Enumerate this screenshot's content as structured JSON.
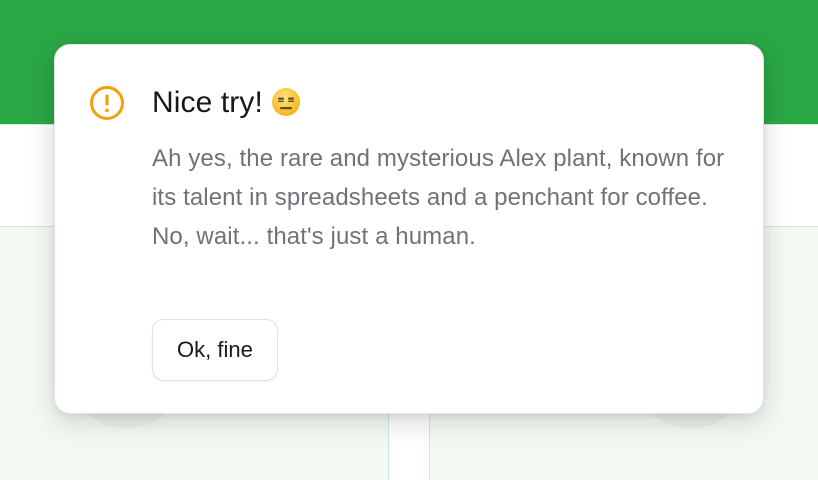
{
  "dialog": {
    "title": "Nice try!",
    "emoji": "😑",
    "icon": "warning-circle-icon",
    "message": "Ah yes, the rare and mysterious Alex plant, known for its talent in spreadsheets and a penchant for coffee. No, wait... that's just a human.",
    "button_label": "Ok, fine"
  },
  "colors": {
    "header_green": "#2aa745",
    "warning_orange": "#f59e0b",
    "title_text": "#18181b",
    "body_text": "#71717a"
  }
}
